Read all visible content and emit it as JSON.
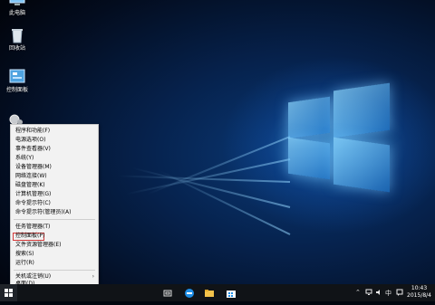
{
  "desktop": {
    "icons": [
      {
        "label": "此电脑",
        "icon": "computer-icon"
      },
      {
        "label": "回收站",
        "icon": "recycle-bin-icon"
      },
      {
        "label": "控制面板",
        "icon": "control-panel-icon"
      }
    ]
  },
  "winx_menu": {
    "items": [
      {
        "label": "程序和功能(F)"
      },
      {
        "label": "电源选项(O)"
      },
      {
        "label": "事件查看器(V)"
      },
      {
        "label": "系统(Y)"
      },
      {
        "label": "设备管理器(M)"
      },
      {
        "label": "网络连接(W)"
      },
      {
        "label": "磁盘管理(K)"
      },
      {
        "label": "计算机管理(G)"
      },
      {
        "label": "命令提示符(C)"
      },
      {
        "label": "命令提示符(管理员)(A)"
      },
      {
        "label": "任务管理器(T)"
      },
      {
        "label": "控制面板(P)"
      },
      {
        "label": "文件资源管理器(E)"
      },
      {
        "label": "搜索(S)"
      },
      {
        "label": "运行(R)"
      },
      {
        "label": "关机或注销(U)"
      },
      {
        "label": "桌面(D)"
      }
    ],
    "highlighted_item": "控制面板(P)"
  },
  "taskbar": {
    "apps": [
      "task-view-icon",
      "edge-icon",
      "file-explorer-icon",
      "store-icon"
    ],
    "tray": {
      "ime": "中",
      "time": "10:43",
      "date": "2015/8/4"
    }
  },
  "colors": {
    "highlight_border": "#d43a3a",
    "taskbar": "#101317",
    "menu_bg": "#f2f2f2"
  }
}
